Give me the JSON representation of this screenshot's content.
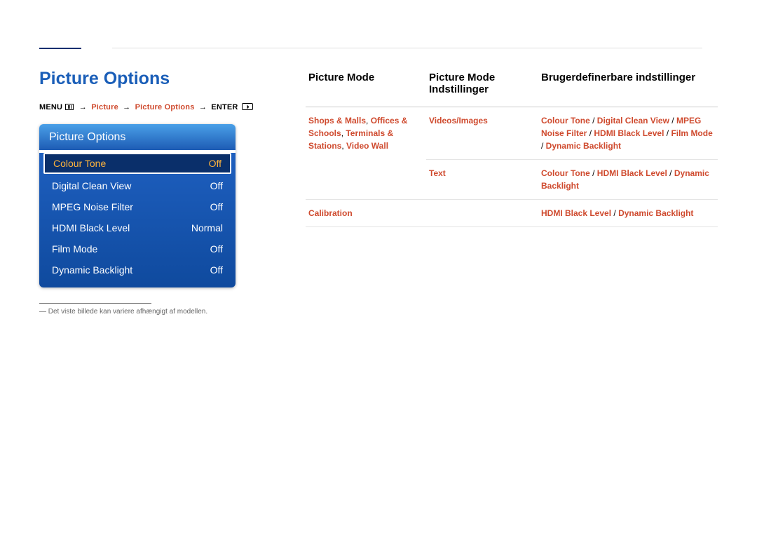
{
  "page_title": "Picture Options",
  "menu_path": {
    "label_menu": "MENU",
    "arrow": "→",
    "step1": "Picture",
    "step2": "Picture Options",
    "label_enter": "ENTER"
  },
  "osd": {
    "header": "Picture Options",
    "rows": [
      {
        "label": "Colour Tone",
        "value": "Off",
        "selected": true
      },
      {
        "label": "Digital Clean View",
        "value": "Off",
        "selected": false
      },
      {
        "label": "MPEG Noise Filter",
        "value": "Off",
        "selected": false
      },
      {
        "label": "HDMI Black Level",
        "value": "Normal",
        "selected": false
      },
      {
        "label": "Film Mode",
        "value": "Off",
        "selected": false
      },
      {
        "label": "Dynamic Backlight",
        "value": "Off",
        "selected": false
      }
    ]
  },
  "note_text": "―  Det viste billede kan variere afhængigt af modellen.",
  "table": {
    "headers": {
      "h1": "Picture Mode",
      "h2": "Picture Mode Indstillinger",
      "h3": "Brugerdefinerbare indstillinger"
    },
    "rows": [
      {
        "c1_parts": [
          "Shops & Malls",
          ", ",
          "Offices & Schools",
          ", ",
          "Terminals & Stations",
          ", ",
          "Video Wall"
        ],
        "c2": "Videos/Images",
        "c3_parts": [
          "Colour Tone",
          " / ",
          "Digital Clean View",
          " / ",
          "MPEG Noise Filter",
          " / ",
          "HDMI Black Level",
          " / ",
          "Film Mode",
          " / ",
          "Dynamic Backlight"
        ]
      },
      {
        "c1_parts": [],
        "c2": "Text",
        "c3_parts": [
          "Colour Tone",
          " / ",
          "HDMI Black Level",
          " / ",
          "Dynamic Backlight"
        ]
      },
      {
        "c1_plain": "Calibration",
        "c2": "",
        "c3_parts": [
          "HDMI Black Level",
          " / ",
          "Dynamic Backlight"
        ]
      }
    ]
  }
}
